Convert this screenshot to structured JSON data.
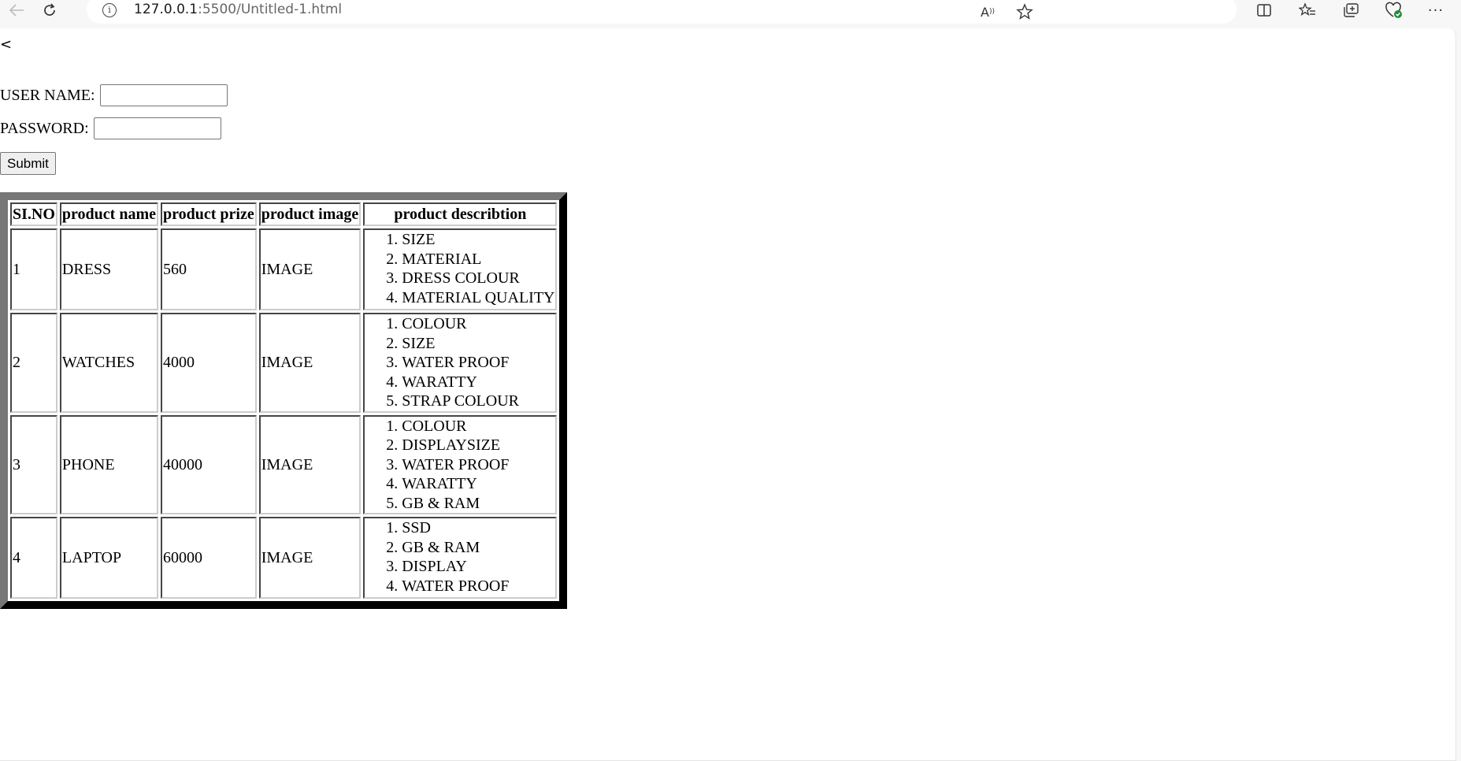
{
  "browser": {
    "url_host": "127.0.0.1",
    "url_path": ":5500/Untitled-1.html"
  },
  "page": {
    "lt_text": "<",
    "username_label": "USER NAME:",
    "username_value": "",
    "password_label": "PASSWORD:",
    "password_value": "",
    "submit_label": "Submit"
  },
  "table": {
    "headers": [
      "SI.NO",
      "product name",
      "product prize",
      "product image",
      "product describtion"
    ],
    "rows": [
      {
        "no": "1",
        "name": "DRESS",
        "prize": "560",
        "image": "IMAGE",
        "desc": [
          "SIZE",
          "MATERIAL",
          "DRESS COLOUR",
          "MATERIAL QUALITY"
        ]
      },
      {
        "no": "2",
        "name": "WATCHES",
        "prize": "4000",
        "image": "IMAGE",
        "desc": [
          "COLOUR",
          "SIZE",
          "WATER PROOF",
          "WARATTY",
          "STRAP COLOUR"
        ]
      },
      {
        "no": "3",
        "name": "PHONE",
        "prize": "40000",
        "image": "IMAGE",
        "desc": [
          "COLOUR",
          "DISPLAYSIZE",
          "WATER PROOF",
          "WARATTY",
          "GB & RAM"
        ]
      },
      {
        "no": "4",
        "name": "LAPTOP",
        "prize": "60000",
        "image": "IMAGE",
        "desc": [
          "SSD",
          "GB & RAM",
          "DISPLAY",
          "WATER PROOF"
        ]
      }
    ]
  }
}
